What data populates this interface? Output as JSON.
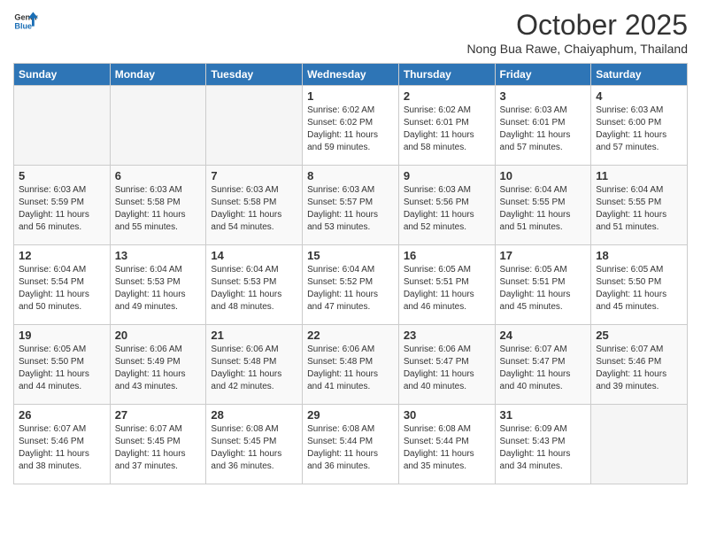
{
  "header": {
    "logo_general": "General",
    "logo_blue": "Blue",
    "month": "October 2025",
    "location": "Nong Bua Rawe, Chaiyaphum, Thailand"
  },
  "days_of_week": [
    "Sunday",
    "Monday",
    "Tuesday",
    "Wednesday",
    "Thursday",
    "Friday",
    "Saturday"
  ],
  "weeks": [
    [
      {
        "day": "",
        "info": ""
      },
      {
        "day": "",
        "info": ""
      },
      {
        "day": "",
        "info": ""
      },
      {
        "day": "1",
        "info": "Sunrise: 6:02 AM\nSunset: 6:02 PM\nDaylight: 11 hours and 59 minutes."
      },
      {
        "day": "2",
        "info": "Sunrise: 6:02 AM\nSunset: 6:01 PM\nDaylight: 11 hours and 58 minutes."
      },
      {
        "day": "3",
        "info": "Sunrise: 6:03 AM\nSunset: 6:01 PM\nDaylight: 11 hours and 57 minutes."
      },
      {
        "day": "4",
        "info": "Sunrise: 6:03 AM\nSunset: 6:00 PM\nDaylight: 11 hours and 57 minutes."
      }
    ],
    [
      {
        "day": "5",
        "info": "Sunrise: 6:03 AM\nSunset: 5:59 PM\nDaylight: 11 hours and 56 minutes."
      },
      {
        "day": "6",
        "info": "Sunrise: 6:03 AM\nSunset: 5:58 PM\nDaylight: 11 hours and 55 minutes."
      },
      {
        "day": "7",
        "info": "Sunrise: 6:03 AM\nSunset: 5:58 PM\nDaylight: 11 hours and 54 minutes."
      },
      {
        "day": "8",
        "info": "Sunrise: 6:03 AM\nSunset: 5:57 PM\nDaylight: 11 hours and 53 minutes."
      },
      {
        "day": "9",
        "info": "Sunrise: 6:03 AM\nSunset: 5:56 PM\nDaylight: 11 hours and 52 minutes."
      },
      {
        "day": "10",
        "info": "Sunrise: 6:04 AM\nSunset: 5:55 PM\nDaylight: 11 hours and 51 minutes."
      },
      {
        "day": "11",
        "info": "Sunrise: 6:04 AM\nSunset: 5:55 PM\nDaylight: 11 hours and 51 minutes."
      }
    ],
    [
      {
        "day": "12",
        "info": "Sunrise: 6:04 AM\nSunset: 5:54 PM\nDaylight: 11 hours and 50 minutes."
      },
      {
        "day": "13",
        "info": "Sunrise: 6:04 AM\nSunset: 5:53 PM\nDaylight: 11 hours and 49 minutes."
      },
      {
        "day": "14",
        "info": "Sunrise: 6:04 AM\nSunset: 5:53 PM\nDaylight: 11 hours and 48 minutes."
      },
      {
        "day": "15",
        "info": "Sunrise: 6:04 AM\nSunset: 5:52 PM\nDaylight: 11 hours and 47 minutes."
      },
      {
        "day": "16",
        "info": "Sunrise: 6:05 AM\nSunset: 5:51 PM\nDaylight: 11 hours and 46 minutes."
      },
      {
        "day": "17",
        "info": "Sunrise: 6:05 AM\nSunset: 5:51 PM\nDaylight: 11 hours and 45 minutes."
      },
      {
        "day": "18",
        "info": "Sunrise: 6:05 AM\nSunset: 5:50 PM\nDaylight: 11 hours and 45 minutes."
      }
    ],
    [
      {
        "day": "19",
        "info": "Sunrise: 6:05 AM\nSunset: 5:50 PM\nDaylight: 11 hours and 44 minutes."
      },
      {
        "day": "20",
        "info": "Sunrise: 6:06 AM\nSunset: 5:49 PM\nDaylight: 11 hours and 43 minutes."
      },
      {
        "day": "21",
        "info": "Sunrise: 6:06 AM\nSunset: 5:48 PM\nDaylight: 11 hours and 42 minutes."
      },
      {
        "day": "22",
        "info": "Sunrise: 6:06 AM\nSunset: 5:48 PM\nDaylight: 11 hours and 41 minutes."
      },
      {
        "day": "23",
        "info": "Sunrise: 6:06 AM\nSunset: 5:47 PM\nDaylight: 11 hours and 40 minutes."
      },
      {
        "day": "24",
        "info": "Sunrise: 6:07 AM\nSunset: 5:47 PM\nDaylight: 11 hours and 40 minutes."
      },
      {
        "day": "25",
        "info": "Sunrise: 6:07 AM\nSunset: 5:46 PM\nDaylight: 11 hours and 39 minutes."
      }
    ],
    [
      {
        "day": "26",
        "info": "Sunrise: 6:07 AM\nSunset: 5:46 PM\nDaylight: 11 hours and 38 minutes."
      },
      {
        "day": "27",
        "info": "Sunrise: 6:07 AM\nSunset: 5:45 PM\nDaylight: 11 hours and 37 minutes."
      },
      {
        "day": "28",
        "info": "Sunrise: 6:08 AM\nSunset: 5:45 PM\nDaylight: 11 hours and 36 minutes."
      },
      {
        "day": "29",
        "info": "Sunrise: 6:08 AM\nSunset: 5:44 PM\nDaylight: 11 hours and 36 minutes."
      },
      {
        "day": "30",
        "info": "Sunrise: 6:08 AM\nSunset: 5:44 PM\nDaylight: 11 hours and 35 minutes."
      },
      {
        "day": "31",
        "info": "Sunrise: 6:09 AM\nSunset: 5:43 PM\nDaylight: 11 hours and 34 minutes."
      },
      {
        "day": "",
        "info": ""
      }
    ]
  ]
}
